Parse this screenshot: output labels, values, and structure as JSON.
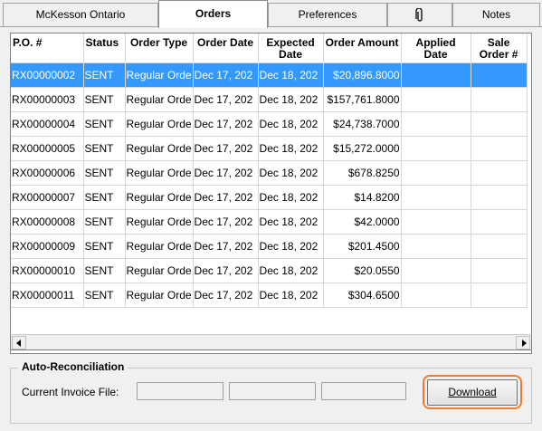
{
  "tabs": [
    {
      "label": "McKesson Ontario",
      "active": false
    },
    {
      "label": "Orders",
      "active": true
    },
    {
      "label": "Preferences",
      "active": false
    },
    {
      "label": "",
      "icon": "paperclip-icon",
      "active": false
    },
    {
      "label": "Notes",
      "active": false
    }
  ],
  "grid": {
    "columns": [
      {
        "key": "po",
        "label": "P.O. #"
      },
      {
        "key": "status",
        "label": "Status"
      },
      {
        "key": "order_type",
        "label": "Order Type"
      },
      {
        "key": "order_date",
        "label": "Order Date"
      },
      {
        "key": "expected_date",
        "label": "Expected Date"
      },
      {
        "key": "order_amount",
        "label": "Order Amount"
      },
      {
        "key": "applied_date",
        "label": "Applied Date"
      },
      {
        "key": "sale_order",
        "label": "Sale Order #"
      }
    ],
    "rows": [
      {
        "po": "RX00000002",
        "status": "SENT",
        "order_type": "Regular Orde",
        "order_date": "Dec 17, 202",
        "expected_date": "Dec 18, 202",
        "order_amount": "$20,896.8000",
        "applied_date": "",
        "sale_order": "",
        "selected": true
      },
      {
        "po": "RX00000003",
        "status": "SENT",
        "order_type": "Regular Orde",
        "order_date": "Dec 17, 202",
        "expected_date": "Dec 18, 202",
        "order_amount": "$157,761.8000",
        "applied_date": "",
        "sale_order": ""
      },
      {
        "po": "RX00000004",
        "status": "SENT",
        "order_type": "Regular Orde",
        "order_date": "Dec 17, 202",
        "expected_date": "Dec 18, 202",
        "order_amount": "$24,738.7000",
        "applied_date": "",
        "sale_order": ""
      },
      {
        "po": "RX00000005",
        "status": "SENT",
        "order_type": "Regular Orde",
        "order_date": "Dec 17, 202",
        "expected_date": "Dec 18, 202",
        "order_amount": "$15,272.0000",
        "applied_date": "",
        "sale_order": ""
      },
      {
        "po": "RX00000006",
        "status": "SENT",
        "order_type": "Regular Orde",
        "order_date": "Dec 17, 202",
        "expected_date": "Dec 18, 202",
        "order_amount": "$678.8250",
        "applied_date": "",
        "sale_order": ""
      },
      {
        "po": "RX00000007",
        "status": "SENT",
        "order_type": "Regular Orde",
        "order_date": "Dec 17, 202",
        "expected_date": "Dec 18, 202",
        "order_amount": "$14.8200",
        "applied_date": "",
        "sale_order": ""
      },
      {
        "po": "RX00000008",
        "status": "SENT",
        "order_type": "Regular Orde",
        "order_date": "Dec 17, 202",
        "expected_date": "Dec 18, 202",
        "order_amount": "$42.0000",
        "applied_date": "",
        "sale_order": ""
      },
      {
        "po": "RX00000009",
        "status": "SENT",
        "order_type": "Regular Orde",
        "order_date": "Dec 17, 202",
        "expected_date": "Dec 18, 202",
        "order_amount": "$201.4500",
        "applied_date": "",
        "sale_order": ""
      },
      {
        "po": "RX00000010",
        "status": "SENT",
        "order_type": "Regular Orde",
        "order_date": "Dec 17, 202",
        "expected_date": "Dec 18, 202",
        "order_amount": "$20.0550",
        "applied_date": "",
        "sale_order": ""
      },
      {
        "po": "RX00000011",
        "status": "SENT",
        "order_type": "Regular Orde",
        "order_date": "Dec 17, 202",
        "expected_date": "Dec 18, 202",
        "order_amount": "$304.6500",
        "applied_date": "",
        "sale_order": ""
      }
    ]
  },
  "scrollbar": {
    "left_icon": "arrow-left-icon",
    "right_icon": "arrow-right-icon"
  },
  "auto_reconciliation": {
    "title": "Auto-Reconciliation",
    "invoice_label": "Current Invoice File:",
    "fields": [
      "",
      "",
      ""
    ],
    "download_label": "Download"
  },
  "colors": {
    "selection": "#3399ff",
    "focus_ring": "#ee7d2b"
  }
}
